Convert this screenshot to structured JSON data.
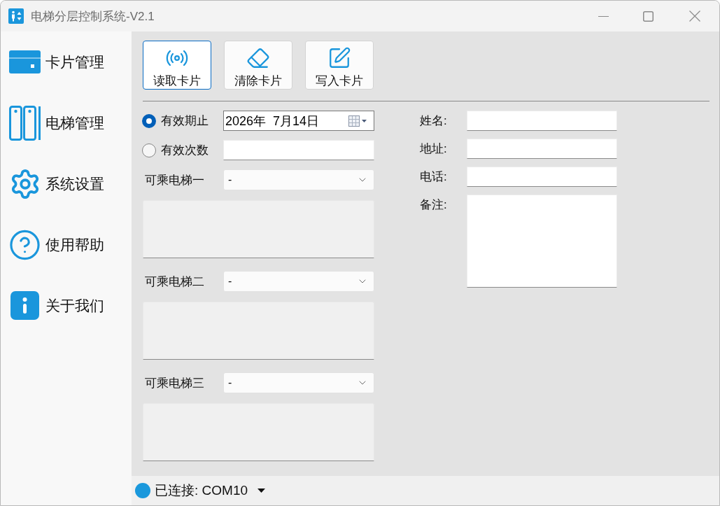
{
  "window": {
    "title": "电梯分层控制系统-V2.1"
  },
  "sidebar": {
    "items": [
      {
        "label": "卡片管理"
      },
      {
        "label": "电梯管理"
      },
      {
        "label": "系统设置"
      },
      {
        "label": "使用帮助"
      },
      {
        "label": "关于我们"
      }
    ]
  },
  "toolbar": {
    "buttons": [
      {
        "label": "读取卡片",
        "selected": true
      },
      {
        "label": "清除卡片",
        "selected": false
      },
      {
        "label": "写入卡片",
        "selected": false
      }
    ]
  },
  "validity": [
    {
      "kind": "date",
      "label": "有效期止",
      "selected": true,
      "value": "2026年  7月14日"
    },
    {
      "kind": "count",
      "label": "有效次数",
      "selected": false
    }
  ],
  "elevators": [
    {
      "label": "可乘电梯一",
      "value": "-"
    },
    {
      "label": "可乘电梯二",
      "value": "-"
    },
    {
      "label": "可乘电梯三",
      "value": "-"
    }
  ],
  "contact_fields": [
    {
      "kind": "line",
      "label": "姓名:"
    },
    {
      "kind": "line",
      "label": "地址:"
    },
    {
      "kind": "line",
      "label": "电话:"
    },
    {
      "kind": "multiline",
      "label": "备注:"
    }
  ],
  "status_bar": {
    "connected": true,
    "text": "已连接: COM10"
  }
}
